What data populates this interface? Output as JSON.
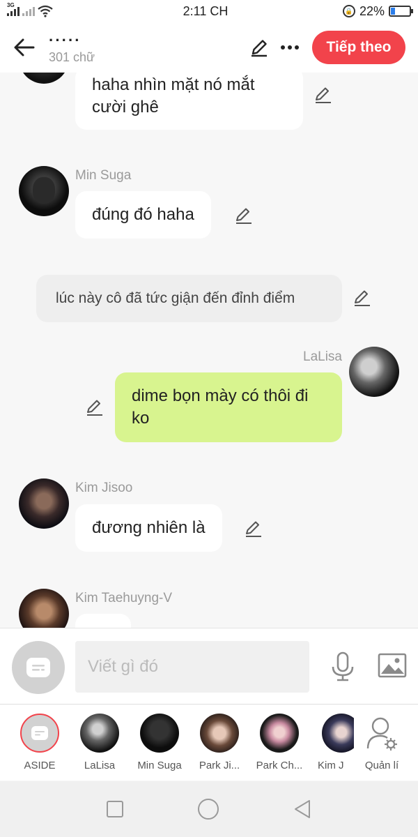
{
  "status": {
    "network": "3G",
    "time": "2:11 CH",
    "battery_percent": "22%",
    "battery_level": 0.22
  },
  "header": {
    "title": "·····",
    "subtitle": "301 chữ",
    "next_label": "Tiếp theo"
  },
  "messages": [
    {
      "type": "left-partial",
      "text": "haha nhìn mặt nó mắt cười ghê"
    },
    {
      "type": "left",
      "name": "Min Suga",
      "text": "đúng đó haha"
    },
    {
      "type": "narration",
      "text": "lúc này cô đã tức giận đến đỉnh điểm"
    },
    {
      "type": "right",
      "name": "LaLisa",
      "text": "dime bọn mày có thôi đi ko"
    },
    {
      "type": "left",
      "name": "Kim Jisoo",
      "text": "đương nhiên là"
    },
    {
      "type": "left-cut",
      "name": "Kim Taehuyng-V",
      "text": ""
    }
  ],
  "input": {
    "placeholder": "Viết gì đó"
  },
  "characters": [
    {
      "label": "ASIDE"
    },
    {
      "label": "LaLisa"
    },
    {
      "label": "Min Suga"
    },
    {
      "label": "Park Ji..."
    },
    {
      "label": "Park Ch..."
    },
    {
      "label": "Kim J"
    },
    {
      "label": "Quản lí"
    }
  ],
  "colors": {
    "accent": "#f2434b",
    "my_bubble": "#d8f48f",
    "narration_bg": "#eeeeee"
  }
}
